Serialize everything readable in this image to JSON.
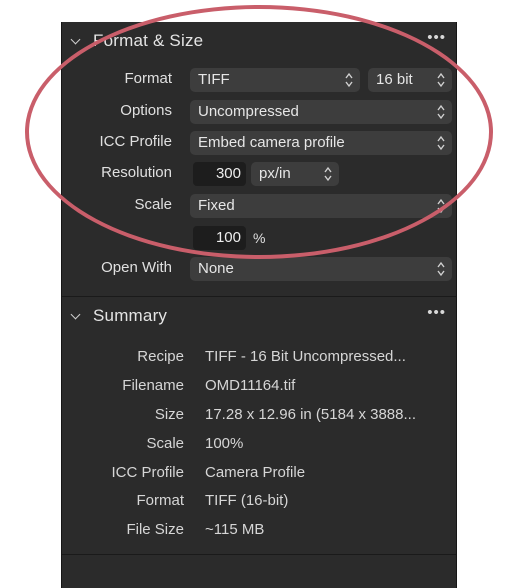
{
  "format_size": {
    "title": "Format & Size",
    "more": "•••",
    "format_label": "Format",
    "format_value": "TIFF",
    "bitdepth_value": "16 bit",
    "options_label": "Options",
    "options_value": "Uncompressed",
    "icc_label": "ICC Profile",
    "icc_value": "Embed camera profile",
    "resolution_label": "Resolution",
    "resolution_value": "300",
    "resolution_unit": "px/in",
    "scale_label": "Scale",
    "scale_value": "Fixed",
    "scale_percent_value": "100",
    "scale_percent_unit": "%",
    "open_with_label": "Open With",
    "open_with_value": "None"
  },
  "summary": {
    "title": "Summary",
    "more": "•••",
    "rows": [
      {
        "label": "Recipe",
        "value": "TIFF -  16 Bit Uncompressed..."
      },
      {
        "label": "Filename",
        "value": "OMD11164.tif"
      },
      {
        "label": "Size",
        "value": "17.28 x 12.96 in (5184 x 3888..."
      },
      {
        "label": "Scale",
        "value": "100%"
      },
      {
        "label": "ICC Profile",
        "value": "Camera Profile"
      },
      {
        "label": "Format",
        "value": "TIFF (16-bit)"
      },
      {
        "label": "File Size",
        "value": " ~115 MB"
      }
    ]
  },
  "colors": {
    "panel_bg": "#2b2b2b",
    "popup_bg": "#3d3d3d",
    "field_bg": "#1d1d1d",
    "annotation_circle": "#c95e6a"
  }
}
